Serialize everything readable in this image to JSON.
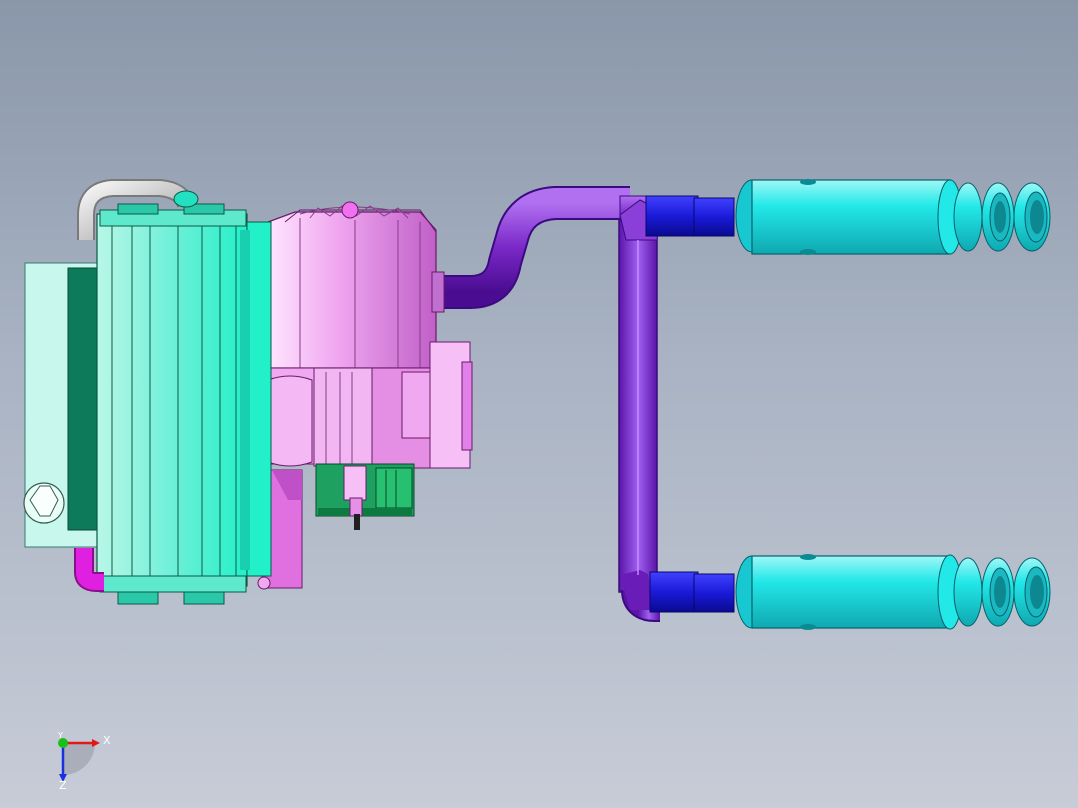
{
  "viewport": {
    "background_top": "#8a97aa",
    "background_bottom": "#c7ccd7"
  },
  "model": {
    "colors": {
      "radiator": "#22f0c8",
      "radiator_light": "#b9f7e7",
      "radiator_dark": "#0d7a5a",
      "motor": "#f0a8f0",
      "motor_dark": "#c060c8",
      "pipe_purple": "#7a28c8",
      "pipe_blue": "#1a1ad8",
      "muffler": "#22e8e8",
      "base_green": "#128a4a",
      "hose_silver": "#c8c8c8",
      "hose_magenta": "#e020e0"
    }
  },
  "triad": {
    "x_label": "X",
    "y_label": "Y",
    "z_label": "Z",
    "x_color": "#e01818",
    "y_color": "#18c018",
    "z_color": "#1830e0"
  }
}
